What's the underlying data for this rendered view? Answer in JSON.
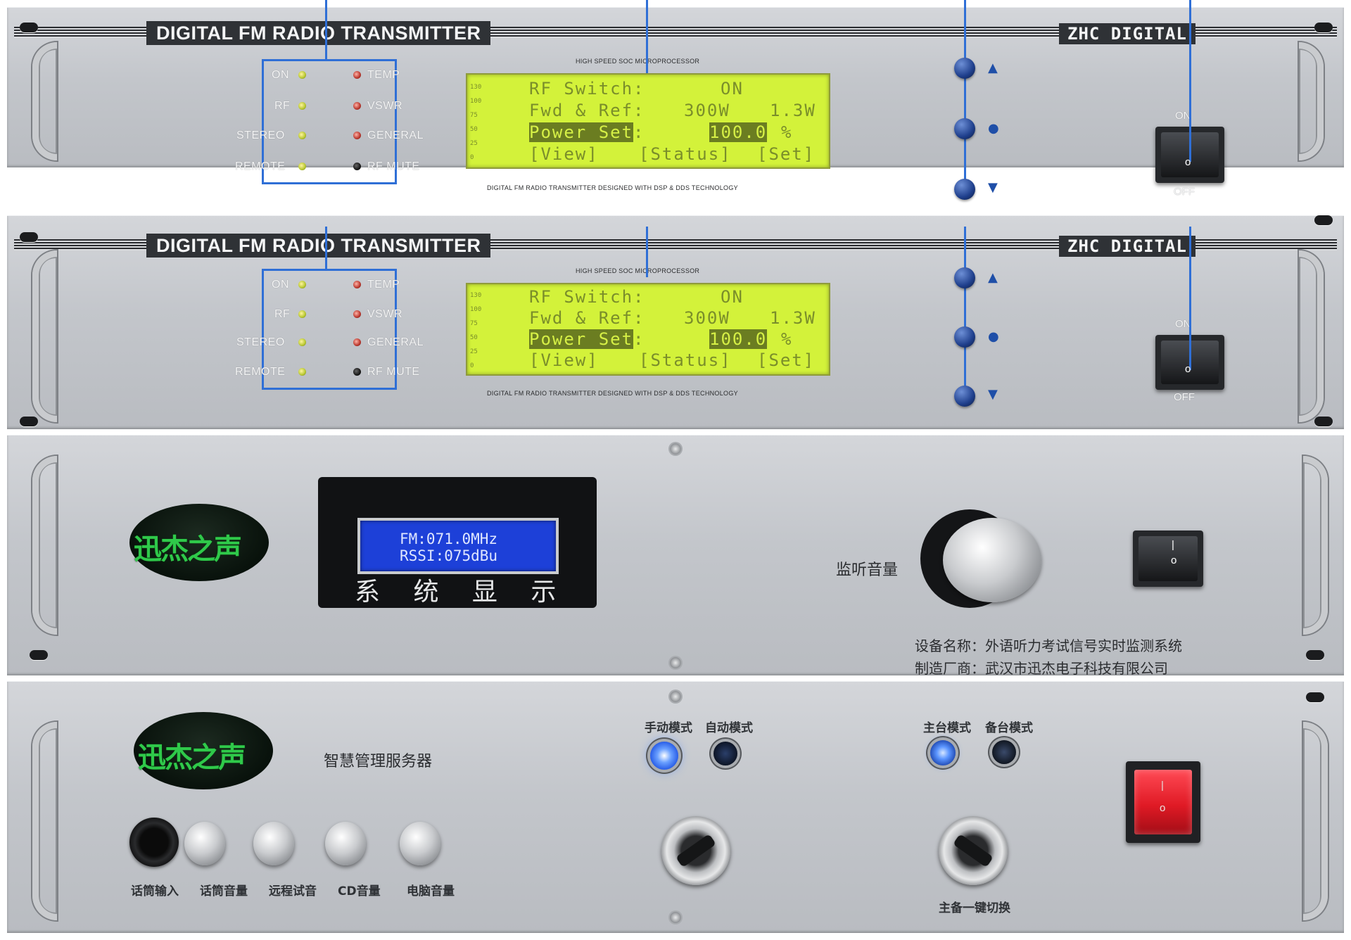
{
  "transmitter": {
    "title": "DIGITAL FM  RADIO TRANSMITTER",
    "brand": "ZHC DIGITAL",
    "microprocessor_text": "HIGH SPEED SOC MICROPROCESSOR",
    "footer_text": "DIGITAL FM RADIO TRANSMITTER DESIGNED WITH DSP & DDS TECHNOLOGY",
    "indicators_left": [
      "ON",
      "RF",
      "STEREO",
      "REMOTE"
    ],
    "indicators_right": [
      "TEMP",
      "VSWR",
      "GENERAL",
      "RF MUTE"
    ],
    "lcd": {
      "row1_label": "RF Switch:",
      "row1_value": "ON",
      "row2_label": "Fwd & Ref:",
      "row2_fwd": "300W",
      "row2_ref": "1.3W",
      "row3_label": "Power Set",
      "row3_colon": ":",
      "row3_value": "100.0",
      "row3_unit": "%",
      "menu": [
        "[View]",
        "[Status]",
        "[Set]"
      ],
      "scale": [
        "130",
        "100",
        "75",
        "50",
        "25",
        "0"
      ]
    },
    "switch_on": "ON",
    "switch_off": "OFF",
    "switch_symbol": "o"
  },
  "monitor": {
    "logo_text": "迅杰之声",
    "display_line1": "FM:071.0MHz",
    "display_line2": "RSSI:075dBu",
    "display_caption": "系 统 显 示",
    "volume_label": "监听音量",
    "device_name": "设备名称：外语听力考试信号实时监测系统",
    "manufacturer": "制造厂商：武汉市迅杰电子科技有限公司",
    "switch_symbols": [
      "|",
      "o"
    ]
  },
  "server": {
    "logo_text": "迅杰之声",
    "title": "智慧管理服务器",
    "mode_manual": "手动模式",
    "mode_auto": "自动模式",
    "mode_main": "主台模式",
    "mode_backup": "备台模式",
    "knob_labels": [
      "话筒输入",
      "话筒音量",
      "远程试音",
      "CD音量",
      "电脑音量"
    ],
    "switch_label": "主备一键切换",
    "switch_symbols": [
      "|",
      "o"
    ],
    "colors": {
      "led_blue": "#3a7bff",
      "power_red": "#e01a25"
    }
  }
}
